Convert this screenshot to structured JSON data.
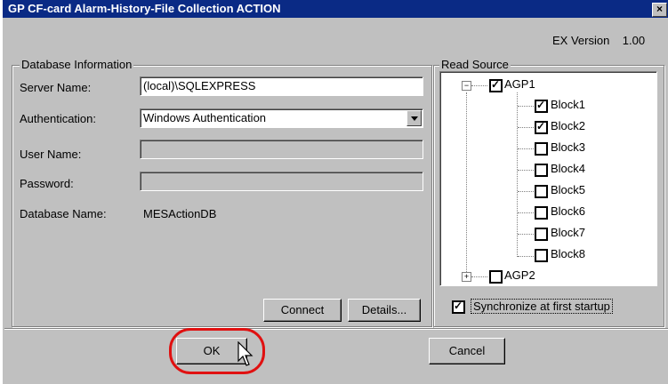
{
  "window": {
    "title": "GP CF-card Alarm-History-File Collection ACTION",
    "close_label": "×"
  },
  "version": {
    "label": "EX Version",
    "number": "1.00"
  },
  "database": {
    "legend": "Database Information",
    "server_label": "Server Name:",
    "server_value": "(local)\\SQLEXPRESS",
    "auth_label": "Authentication:",
    "auth_value": "Windows Authentication",
    "user_label": "User Name:",
    "user_value": "",
    "password_label": "Password:",
    "password_value": "",
    "dbname_label": "Database Name:",
    "dbname_value": "MESActionDB",
    "connect_label": "Connect",
    "details_label": "Details..."
  },
  "read_source": {
    "legend": "Read Source",
    "groups": [
      {
        "label": "AGP1",
        "expanded": true,
        "checked": true,
        "blocks": [
          {
            "label": "Block1",
            "checked": true
          },
          {
            "label": "Block2",
            "checked": true
          },
          {
            "label": "Block3",
            "checked": false
          },
          {
            "label": "Block4",
            "checked": false
          },
          {
            "label": "Block5",
            "checked": false
          },
          {
            "label": "Block6",
            "checked": false
          },
          {
            "label": "Block7",
            "checked": false
          },
          {
            "label": "Block8",
            "checked": false
          }
        ]
      },
      {
        "label": "AGP2",
        "expanded": false,
        "checked": false
      }
    ],
    "sync_label": "Synchronize at first startup",
    "sync_checked": true
  },
  "footer": {
    "ok_label": "OK",
    "cancel_label": "Cancel"
  },
  "colors": {
    "titlebar": "#0a2a85",
    "face": "#c0c0c0",
    "highlight_ring": "#e01010"
  }
}
